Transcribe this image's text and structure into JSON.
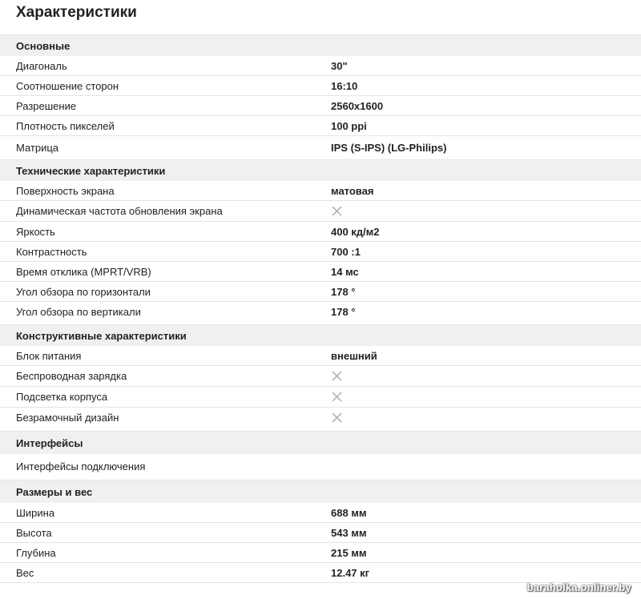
{
  "page": {
    "title": "Характеристики"
  },
  "sections": {
    "basic": {
      "title": "Основные",
      "rows": [
        {
          "name": "Диагональ",
          "value": "30\""
        },
        {
          "name": "Соотношение сторон",
          "value": "16:10"
        },
        {
          "name": "Разрешение",
          "value": "2560x1600"
        },
        {
          "name": "Плотность пикселей",
          "value": "100 ppi"
        },
        {
          "name": "Матрица",
          "value": "IPS (S-IPS) (LG-Philips)"
        }
      ]
    },
    "technical": {
      "title": "Технические характеристики",
      "rows": [
        {
          "name": "Поверхность экрана",
          "value": "матовая"
        },
        {
          "name": "Динамическая частота обновления экрана",
          "value": "",
          "icon": "cross-icon"
        },
        {
          "name": "Яркость",
          "value": "400 кд/м2"
        },
        {
          "name": "Контрастность",
          "value": "700 :1"
        },
        {
          "name": "Время отклика (MPRT/VRB)",
          "value": "14 мс"
        },
        {
          "name": "Угол обзора по горизонтали",
          "value": "178 °"
        },
        {
          "name": "Угол обзора по вертикали",
          "value": "178 °"
        }
      ]
    },
    "construction": {
      "title": "Конструктивные характеристики",
      "rows": [
        {
          "name": "Блок питания",
          "value": "внешний"
        },
        {
          "name": "Беспроводная зарядка",
          "value": "",
          "icon": "cross-icon"
        },
        {
          "name": "Подсветка корпуса",
          "value": "",
          "icon": "cross-icon"
        },
        {
          "name": "Безрамочный дизайн",
          "value": "",
          "icon": "cross-icon"
        }
      ]
    },
    "interfaces": {
      "title": "Интерфейсы",
      "rows": [
        {
          "name": "Интерфейсы подключения",
          "value": ""
        }
      ]
    },
    "dimensions": {
      "title": "Размеры и вес",
      "rows": [
        {
          "name": "Ширина",
          "value": "688 мм"
        },
        {
          "name": "Высота",
          "value": "543 мм"
        },
        {
          "name": "Глубина",
          "value": "215 мм"
        },
        {
          "name": "Вес",
          "value": "12.47 кг"
        }
      ]
    }
  },
  "colors": {
    "section_bg": "#f0f0f0",
    "divider": "#e4e4e4",
    "cross": "#b5b5b5"
  },
  "watermark": {
    "text": "baraholka.onliner.by"
  }
}
